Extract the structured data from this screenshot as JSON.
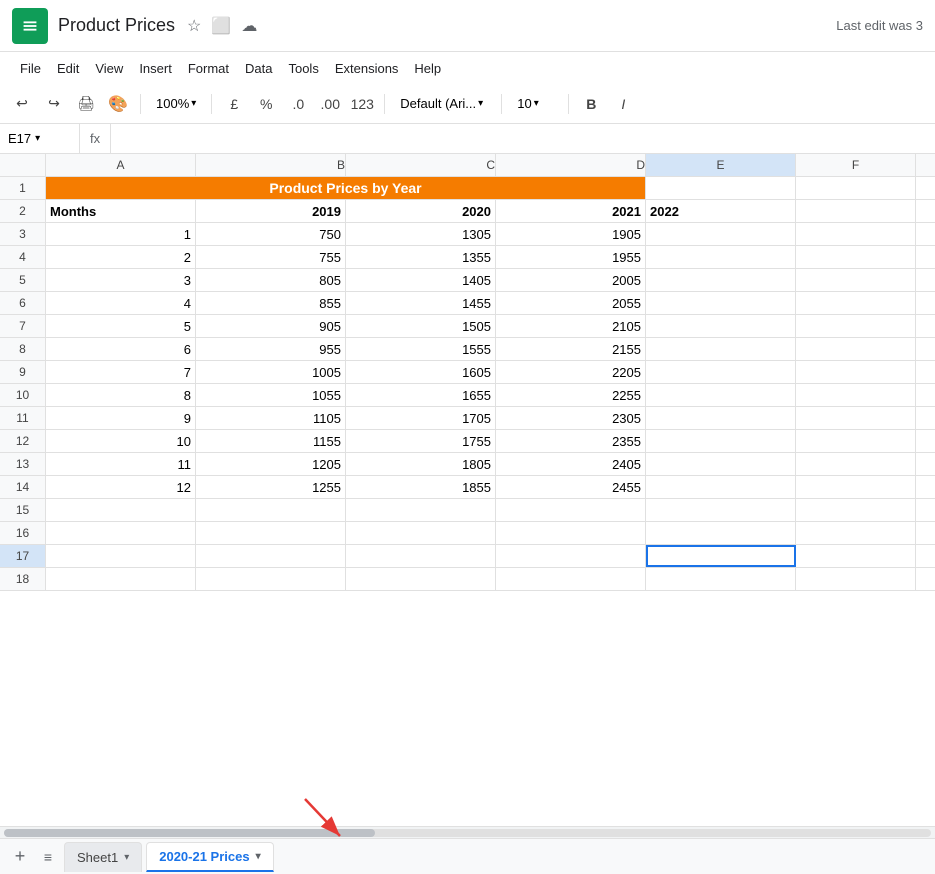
{
  "title": "Product Prices",
  "last_edit": "Last edit was 3",
  "app_icon_alt": "Google Sheets",
  "menu": {
    "items": [
      "File",
      "Edit",
      "View",
      "Insert",
      "Format",
      "Data",
      "Tools",
      "Extensions",
      "Help"
    ]
  },
  "toolbar": {
    "zoom": "100%",
    "currency": "£",
    "percent": "%",
    "decimal_inc": ".0",
    "decimal_dec": ".00",
    "format_123": "123",
    "font": "Default (Ari...",
    "font_size": "10",
    "bold": "B",
    "italic": "I"
  },
  "formula_bar": {
    "cell_ref": "E17",
    "fx": "fx"
  },
  "columns": {
    "row_num_width": 46,
    "headers": [
      "A",
      "B",
      "C",
      "D",
      "E",
      "F"
    ]
  },
  "spreadsheet_title": "Product Prices by Year",
  "header_row": {
    "a": "Months",
    "b": "2019",
    "c": "2020",
    "d": "2021",
    "e": "2022"
  },
  "data_rows": [
    {
      "num": "3",
      "a": "1",
      "b": "750",
      "c": "1305",
      "d": "1905",
      "e": ""
    },
    {
      "num": "4",
      "a": "2",
      "b": "755",
      "c": "1355",
      "d": "1955",
      "e": ""
    },
    {
      "num": "5",
      "a": "3",
      "b": "805",
      "c": "1405",
      "d": "2005",
      "e": ""
    },
    {
      "num": "6",
      "a": "4",
      "b": "855",
      "c": "1455",
      "d": "2055",
      "e": ""
    },
    {
      "num": "7",
      "a": "5",
      "b": "905",
      "c": "1505",
      "d": "2105",
      "e": ""
    },
    {
      "num": "8",
      "a": "6",
      "b": "955",
      "c": "1555",
      "d": "2155",
      "e": ""
    },
    {
      "num": "9",
      "a": "7",
      "b": "1005",
      "c": "1605",
      "d": "2205",
      "e": ""
    },
    {
      "num": "10",
      "a": "8",
      "b": "1055",
      "c": "1655",
      "d": "2255",
      "e": ""
    },
    {
      "num": "11",
      "a": "9",
      "b": "1105",
      "c": "1705",
      "d": "2305",
      "e": ""
    },
    {
      "num": "12",
      "a": "10",
      "b": "1155",
      "c": "1755",
      "d": "2355",
      "e": ""
    },
    {
      "num": "13",
      "a": "11",
      "b": "1205",
      "c": "1805",
      "d": "2405",
      "e": ""
    },
    {
      "num": "14",
      "a": "12",
      "b": "1255",
      "c": "1855",
      "d": "2455",
      "e": ""
    },
    {
      "num": "15",
      "a": "",
      "b": "",
      "c": "",
      "d": "",
      "e": ""
    },
    {
      "num": "16",
      "a": "",
      "b": "",
      "c": "",
      "d": "",
      "e": ""
    },
    {
      "num": "17",
      "a": "",
      "b": "",
      "c": "",
      "d": "",
      "e": ""
    },
    {
      "num": "18",
      "a": "",
      "b": "",
      "c": "",
      "d": "",
      "e": ""
    }
  ],
  "sheets": [
    {
      "name": "Sheet1",
      "active": false
    },
    {
      "name": "2020-21 Prices",
      "active": true
    }
  ],
  "colors": {
    "orange": "#f57c00",
    "blue_selected": "#1a73e8"
  }
}
